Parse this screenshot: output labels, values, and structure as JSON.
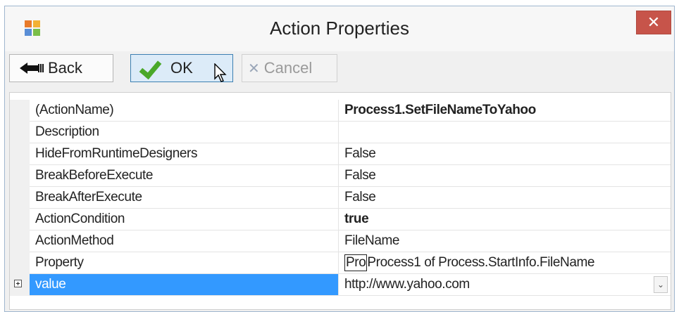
{
  "dialog": {
    "title": "Action Properties",
    "close_label": "✕"
  },
  "toolbar": {
    "back_label": "Back",
    "ok_label": "OK",
    "cancel_label": "Cancel",
    "cancel_icon": "✕"
  },
  "properties": [
    {
      "name": "(ActionName)",
      "value": "Process1.SetFileNameToYahoo"
    },
    {
      "name": "Description",
      "value": ""
    },
    {
      "name": "HideFromRuntimeDesigners",
      "value": "False"
    },
    {
      "name": "BreakBeforeExecute",
      "value": "False"
    },
    {
      "name": "BreakAfterExecute",
      "value": "False"
    },
    {
      "name": "ActionCondition",
      "value": "true"
    },
    {
      "name": "ActionMethod",
      "value": "FileName"
    },
    {
      "name": "Property",
      "value_box": "Pro",
      "value_rest": "Process1 of Process.StartInfo.FileName"
    },
    {
      "name": "value",
      "value": "http://www.yahoo.com"
    }
  ],
  "dropdown_glyph": "⌄",
  "colors": {
    "selection": "#3399ff",
    "close_button": "#c7544a",
    "ok_check": "#4aa829"
  }
}
